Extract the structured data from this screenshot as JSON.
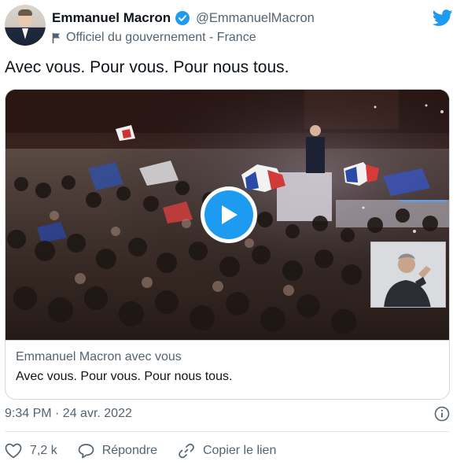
{
  "author": {
    "name": "Emmanuel Macron",
    "handle": "@EmmanuelMacron",
    "label": "Officiel du gouvernement - France"
  },
  "tweet": {
    "text": "Avec vous. Pour vous. Pour nous tous."
  },
  "card": {
    "title": "Emmanuel Macron avec vous",
    "description": "Avec vous. Pour vous. Pour nous tous."
  },
  "meta": {
    "timestamp": "9:34 PM · 24 avr. 2022"
  },
  "actions": {
    "likes": "7,2 k",
    "reply": "Répondre",
    "copy_link": "Copier le lien"
  },
  "colors": {
    "accent": "#1d9bf0",
    "text": "#0f1419",
    "secondary": "#536471"
  },
  "icons": {
    "verified": "verified-badge-icon",
    "label": "flag-icon",
    "brand": "twitter-bird-icon",
    "play": "play-icon",
    "info": "info-icon",
    "like": "heart-icon",
    "reply": "speech-bubble-icon",
    "link": "link-icon"
  }
}
